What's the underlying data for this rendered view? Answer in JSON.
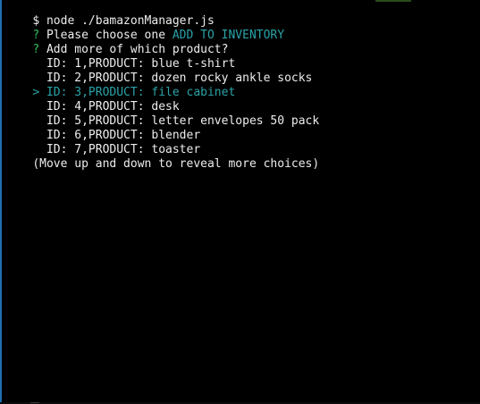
{
  "command_line": {
    "prompt_symbol": "$",
    "command": "node ./bamazonManager.js"
  },
  "question_menu": {
    "mark": "?",
    "text": "Please choose one",
    "answer": "ADD TO INVENTORY"
  },
  "question_product": {
    "mark": "?",
    "text": "Add more of which product?"
  },
  "choices": [
    {
      "text": "ID: 1,PRODUCT: blue t-shirt"
    },
    {
      "text": "ID: 2,PRODUCT: dozen rocky ankle socks"
    },
    {
      "text": "ID: 3,PRODUCT: file cabinet"
    },
    {
      "text": "ID: 4,PRODUCT: desk"
    },
    {
      "text": "ID: 5,PRODUCT: letter envelopes 50 pack"
    },
    {
      "text": "ID: 6,PRODUCT: blender"
    },
    {
      "text": "ID: 7,PRODUCT: toaster"
    }
  ],
  "selected_pointer": ">",
  "hint": "(Move up and down to reveal more choices)",
  "colors": {
    "background": "#000000",
    "text": "#e8e8e8",
    "prompt_green": "#31c05a",
    "highlight_cyan": "#2aa3a8"
  }
}
